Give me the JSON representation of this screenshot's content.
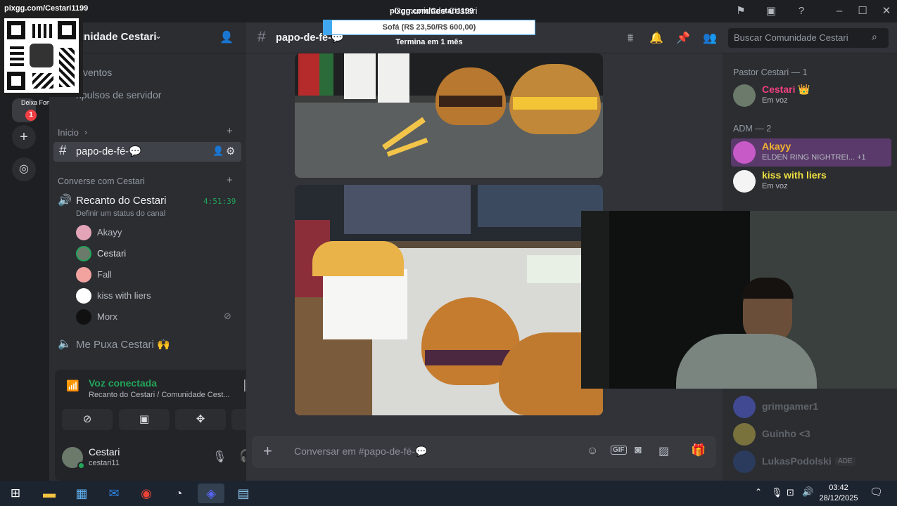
{
  "window": {
    "title": "Comunidade Cestari"
  },
  "overlay": {
    "qr_url": "pixgg.com/Cestari1199",
    "goal_title": "pixgg.com/Cestari1199",
    "goal_text": "Sofá (R$ 23,50/R$ 600,00)",
    "goal_progress": 0.039,
    "goal_sub": "Termina em 1 mês",
    "badge_label": "Deixa Forte",
    "badge_count": "1"
  },
  "server": {
    "name": "unidade Cestari",
    "events_label": "ventos",
    "boosts_label": "npulsos de servidor",
    "category_start": "Início",
    "active_channel": "papo-de-fé-💬",
    "category_voice": "Converse com Cestari",
    "voice_channel": "Recanto do Cestari",
    "voice_timer": "4:51:39",
    "voice_status": "Definir um status do canal",
    "voice_users": [
      "Akayy",
      "Cestari",
      "Fall",
      "kiss with liers",
      "Morx"
    ],
    "voice_channel_2": "Me Puxa Cestari 🙌"
  },
  "voice_panel": {
    "status": "Voz conectada",
    "location": "Recanto do Cestari / Comunidade Cest..."
  },
  "user": {
    "name": "Cestari",
    "tag": "cestari11"
  },
  "chat": {
    "channel": "papo-de-fé-💬",
    "search_placeholder": "Buscar Comunidade Cestari",
    "composer_placeholder": "Conversar em #papo-de-fé-💬"
  },
  "members": {
    "group1": "Pastor Cestari — 1",
    "group2": "ADM — 2",
    "list": [
      {
        "name": "Cestari 👑",
        "sub": "Em voz",
        "color": "#f23f80"
      },
      {
        "name": "Akayy",
        "sub": "ELDEN RING NIGHTREI...  +1",
        "color": "#f0b232"
      },
      {
        "name": "kiss with liers",
        "sub": "Em voz",
        "color": "#f0e040"
      },
      {
        "name": "grimgamer1",
        "sub": "",
        "color": "#80848e"
      },
      {
        "name": "Guinho <3",
        "sub": "",
        "color": "#80848e"
      },
      {
        "name": "LukasPodolski",
        "sub": "ADE",
        "color": "#80848e"
      }
    ]
  },
  "taskbar": {
    "time": "03:42",
    "date": "28/12/2025"
  }
}
